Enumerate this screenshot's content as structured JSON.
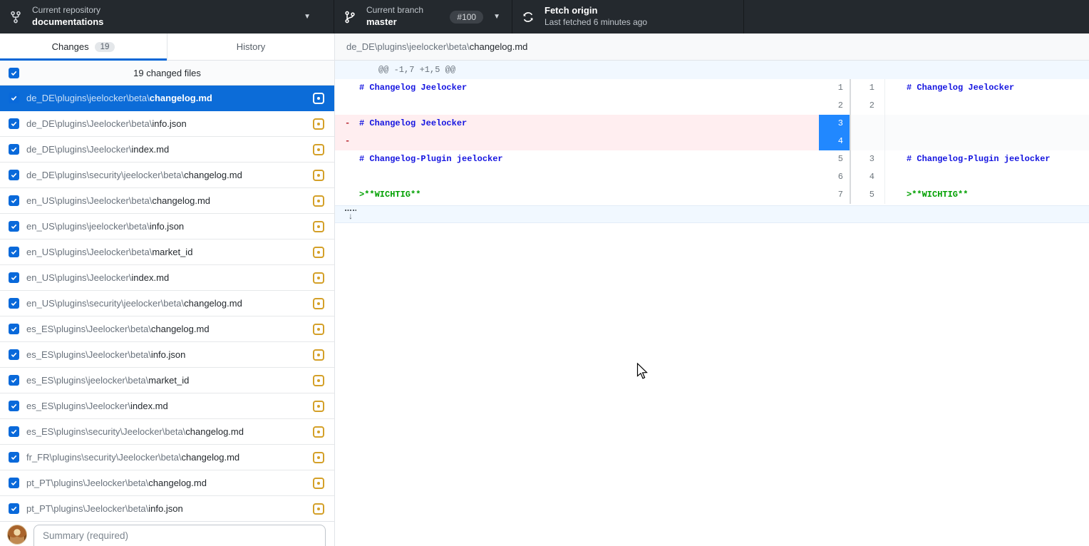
{
  "topbar": {
    "repo": {
      "label": "Current repository",
      "name": "documentations"
    },
    "branch": {
      "label": "Current branch",
      "name": "master",
      "badge": "#100"
    },
    "fetch": {
      "title": "Fetch origin",
      "subtitle": "Last fetched 6 minutes ago"
    }
  },
  "tabs": {
    "changes_label": "Changes",
    "changes_count": "19",
    "history_label": "History"
  },
  "files": {
    "header_label": "19 changed files",
    "items": [
      {
        "dir": "de_DE\\plugins\\jeelocker\\beta\\",
        "name": "changelog.md",
        "status": "modified",
        "checked": true,
        "selected": true
      },
      {
        "dir": "de_DE\\plugins\\Jeelocker\\beta\\",
        "name": "info.json",
        "status": "modified",
        "checked": true
      },
      {
        "dir": "de_DE\\plugins\\Jeelocker\\",
        "name": "index.md",
        "status": "modified",
        "checked": true
      },
      {
        "dir": "de_DE\\plugins\\security\\jeelocker\\beta\\",
        "name": "changelog.md",
        "status": "modified",
        "checked": true
      },
      {
        "dir": "en_US\\plugins\\Jeelocker\\beta\\",
        "name": "changelog.md",
        "status": "modified",
        "checked": true
      },
      {
        "dir": "en_US\\plugins\\jeelocker\\beta\\",
        "name": "info.json",
        "status": "modified",
        "checked": true
      },
      {
        "dir": "en_US\\plugins\\Jeelocker\\beta\\",
        "name": "market_id",
        "status": "modified",
        "checked": true
      },
      {
        "dir": "en_US\\plugins\\Jeelocker\\",
        "name": "index.md",
        "status": "modified",
        "checked": true
      },
      {
        "dir": "en_US\\plugins\\security\\jeelocker\\beta\\",
        "name": "changelog.md",
        "status": "modified",
        "checked": true
      },
      {
        "dir": "es_ES\\plugins\\Jeelocker\\beta\\",
        "name": "changelog.md",
        "status": "modified",
        "checked": true
      },
      {
        "dir": "es_ES\\plugins\\Jeelocker\\beta\\",
        "name": "info.json",
        "status": "modified",
        "checked": true
      },
      {
        "dir": "es_ES\\plugins\\jeelocker\\beta\\",
        "name": "market_id",
        "status": "modified",
        "checked": true
      },
      {
        "dir": "es_ES\\plugins\\Jeelocker\\",
        "name": "index.md",
        "status": "modified",
        "checked": true
      },
      {
        "dir": "es_ES\\plugins\\security\\Jeelocker\\beta\\",
        "name": "changelog.md",
        "status": "modified",
        "checked": true
      },
      {
        "dir": "fr_FR\\plugins\\security\\Jeelocker\\beta\\",
        "name": "changelog.md",
        "status": "modified",
        "checked": true
      },
      {
        "dir": "pt_PT\\plugins\\Jeelocker\\beta\\",
        "name": "changelog.md",
        "status": "modified",
        "checked": true
      },
      {
        "dir": "pt_PT\\plugins\\Jeelocker\\beta\\",
        "name": "info.json",
        "status": "modified",
        "checked": true
      }
    ]
  },
  "diff": {
    "file_dir": "de_DE\\plugins\\jeelocker\\beta\\",
    "file_name": "changelog.md",
    "hunk_header": "@@ -1,7 +1,5 @@",
    "rows": [
      {
        "left_marker": "",
        "left_text": "# Changelog Jeelocker",
        "left_class": "md-blue",
        "old": "1",
        "new": "1",
        "right_text": "# Changelog Jeelocker",
        "right_class": "md-blue",
        "type": "context"
      },
      {
        "left_marker": "",
        "left_text": "",
        "left_class": "",
        "old": "2",
        "new": "2",
        "right_text": "",
        "right_class": "",
        "type": "context"
      },
      {
        "left_marker": "-",
        "left_text": "# Changelog Jeelocker",
        "left_class": "md-blue",
        "old": "3",
        "new": "",
        "right_text": "",
        "right_class": "",
        "type": "deleted",
        "selected": true
      },
      {
        "left_marker": "-",
        "left_text": "",
        "left_class": "",
        "old": "4",
        "new": "",
        "right_text": "",
        "right_class": "",
        "type": "deleted",
        "selected": true
      },
      {
        "left_marker": "",
        "left_text": "# Changelog-Plugin jeelocker",
        "left_class": "md-blue",
        "old": "5",
        "new": "3",
        "right_text": "# Changelog-Plugin jeelocker",
        "right_class": "md-blue",
        "type": "context"
      },
      {
        "left_marker": "",
        "left_text": "",
        "left_class": "",
        "old": "6",
        "new": "4",
        "right_text": "",
        "right_class": "",
        "type": "context"
      },
      {
        "left_marker": "",
        "left_text": ">**WICHTIG**",
        "left_class": "md-green",
        "old": "7",
        "new": "5",
        "right_text": ">**WICHTIG**",
        "right_class": "md-green",
        "type": "context"
      }
    ]
  },
  "commit": {
    "summary_placeholder": "Summary (required)"
  },
  "colors": {
    "topbar_bg": "#24292e",
    "selection_blue": "#0c6cd8",
    "gutter_selected_blue": "#2188ff",
    "active_tab_underline": "#0366d6",
    "checkbox_blue": "#0969da",
    "modified_icon_yellow": "#d4a028",
    "deleted_line_bg": "#ffeef0",
    "hunk_header_bg": "#f1f8ff",
    "code_blue": "#1414e0",
    "code_green": "#00a000"
  }
}
